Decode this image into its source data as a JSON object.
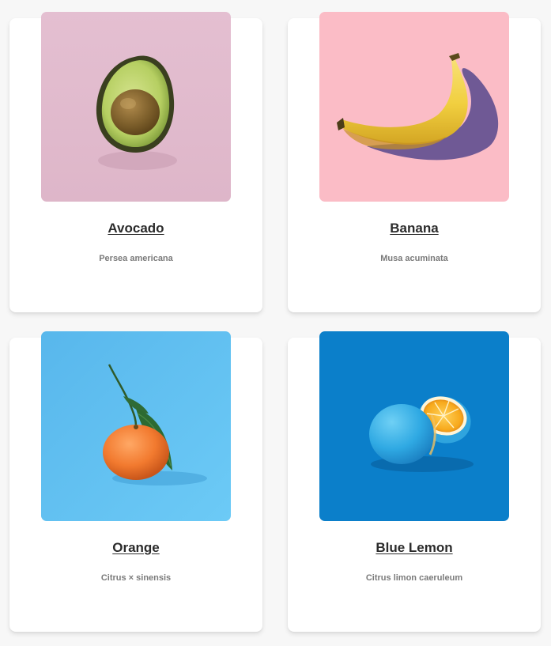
{
  "fruits": [
    {
      "name": "Avocado",
      "scientific": "Persea americana",
      "image": "avocado-on-pink"
    },
    {
      "name": "Banana",
      "scientific": "Musa acuminata",
      "image": "banana-on-pink"
    },
    {
      "name": "Orange",
      "scientific": "Citrus × sinensis",
      "image": "orange-on-light-blue"
    },
    {
      "name": "Blue Lemon",
      "scientific": "Citrus limon caeruleum",
      "image": "blue-lemon-on-blue"
    }
  ],
  "colors": {
    "avocado_bg": "#e3bdd0",
    "banana_bg": "#fbbcc6",
    "orange_bg": "#5cc0f0",
    "lemon_bg": "#0b7fca"
  }
}
